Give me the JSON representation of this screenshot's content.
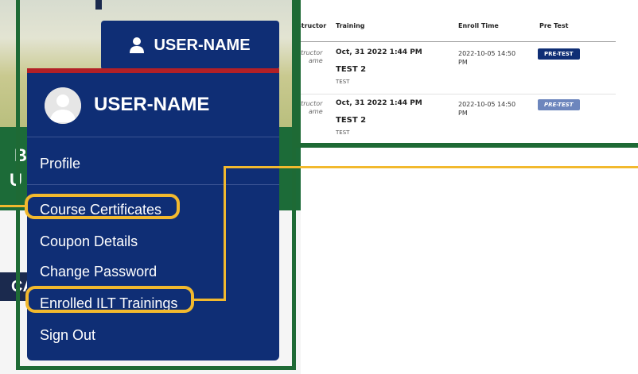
{
  "user_button": {
    "label": "USER-NAME",
    "icon": "user-icon"
  },
  "dropdown": {
    "username": "USER-NAME",
    "items": [
      {
        "label": "Profile"
      },
      {
        "label": "Course Certificates"
      },
      {
        "label": "Coupon Details"
      },
      {
        "label": "Change Password"
      },
      {
        "label": "Enrolled ILT Trainings"
      },
      {
        "label": "Sign Out"
      }
    ]
  },
  "background_fragments": {
    "b": "B",
    "u": "U",
    "ca": "CA"
  },
  "table": {
    "headers": [
      "structor",
      "Training",
      "Enroll Time",
      "Pre Test"
    ],
    "rows": [
      {
        "instructor": "structor\name",
        "instructor_line1": "structor",
        "instructor_line2": "ame",
        "date": "Oct, 31 2022 1:44 PM",
        "training": "TEST 2",
        "sub": "TEST",
        "enroll_line1": "2022-10-05 14:50",
        "enroll_line2": "PM",
        "pretest": "PRE-TEST"
      },
      {
        "instructor_line1": "structor",
        "instructor_line2": "ame",
        "date": "Oct, 31 2022 1:44 PM",
        "training": "TEST 2",
        "sub": "TEST",
        "enroll_line1": "2022-10-05 14:50",
        "enroll_line2": "PM",
        "pretest": "PRE-TEST"
      }
    ]
  },
  "colors": {
    "navy": "#0f2e75",
    "green": "#1e6a35",
    "highlight": "#f2b92e",
    "accent_red": "#b22026"
  }
}
